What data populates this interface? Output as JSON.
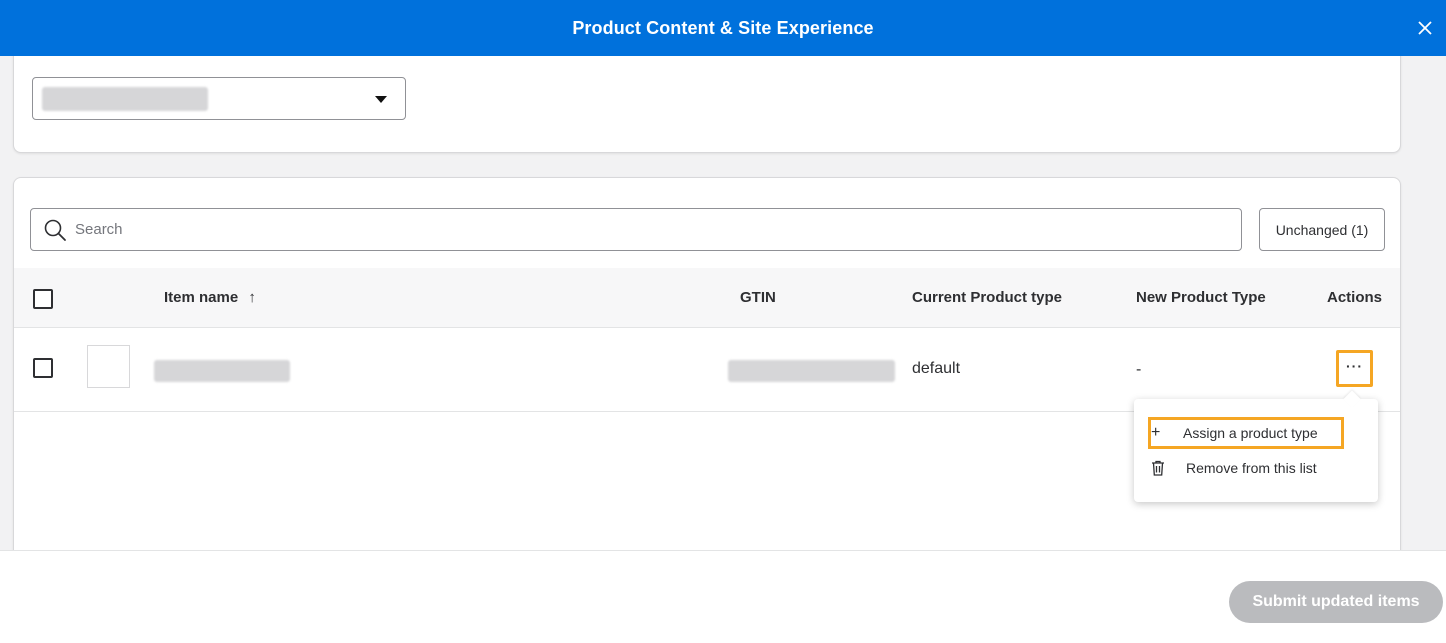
{
  "header": {
    "title": "Product Content & Site Experience",
    "close_icon": "close-icon"
  },
  "filter": {
    "selected_value": "",
    "icon": "caret-down-icon"
  },
  "search": {
    "placeholder": "Search",
    "value": "",
    "icon": "search-icon"
  },
  "status_filter": {
    "label": "Unchanged (1)"
  },
  "table": {
    "columns": {
      "item_name": "Item name",
      "sort_arrow": "↑",
      "gtin": "GTIN",
      "current_type": "Current Product type",
      "new_type": "New Product Type",
      "actions": "Actions"
    },
    "rows": [
      {
        "item_name": "",
        "gtin": "",
        "current_type": "default",
        "new_type": "-",
        "actions_label": "···"
      }
    ]
  },
  "actions_menu": {
    "items": [
      {
        "label": "Assign a product type",
        "icon": "plus-icon",
        "glyph": "+"
      },
      {
        "label": "Remove from this list",
        "icon": "trash-icon"
      }
    ]
  },
  "footer": {
    "submit_label": "Submit updated items"
  },
  "colors": {
    "header_bg": "#0071dc",
    "highlight": "#f5a623",
    "submit_disabled": "#babbbe"
  }
}
